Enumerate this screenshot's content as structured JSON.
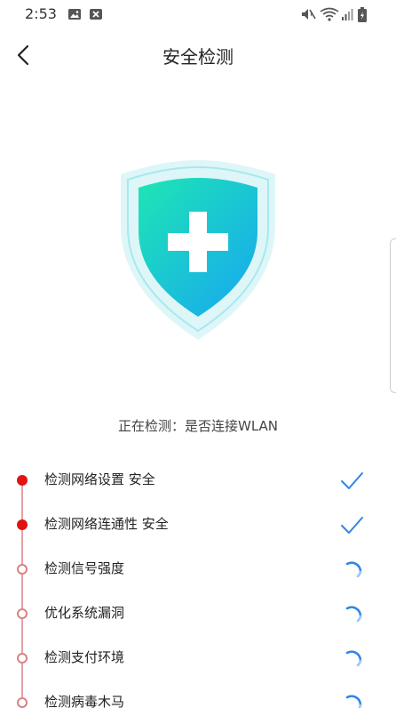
{
  "status_bar": {
    "time": "2:53"
  },
  "nav": {
    "title": "安全检测"
  },
  "detection": {
    "status_text": "正在检测：是否连接WLAN"
  },
  "checks": [
    {
      "label": "检测网络设置 安全",
      "state": "done"
    },
    {
      "label": "检测网络连通性 安全",
      "state": "done"
    },
    {
      "label": "检测信号强度",
      "state": "loading"
    },
    {
      "label": "优化系统漏洞",
      "state": "loading"
    },
    {
      "label": "检测支付环境",
      "state": "loading"
    },
    {
      "label": "检测病毒木马",
      "state": "loading"
    }
  ],
  "colors": {
    "accent_red": "#e11313",
    "check_blue": "#2f86e6",
    "shield_green": "#1ee6b4",
    "shield_blue": "#17a6f2"
  },
  "icons": {
    "status_bar": [
      "image-icon",
      "close-box-icon",
      "mute-icon",
      "wifi-icon",
      "signal-icon",
      "battery-icon"
    ],
    "back": "chevron-left-icon",
    "hero": "shield-plus-icon",
    "done": "checkmark-icon",
    "loading": "loading-spinner-icon"
  }
}
